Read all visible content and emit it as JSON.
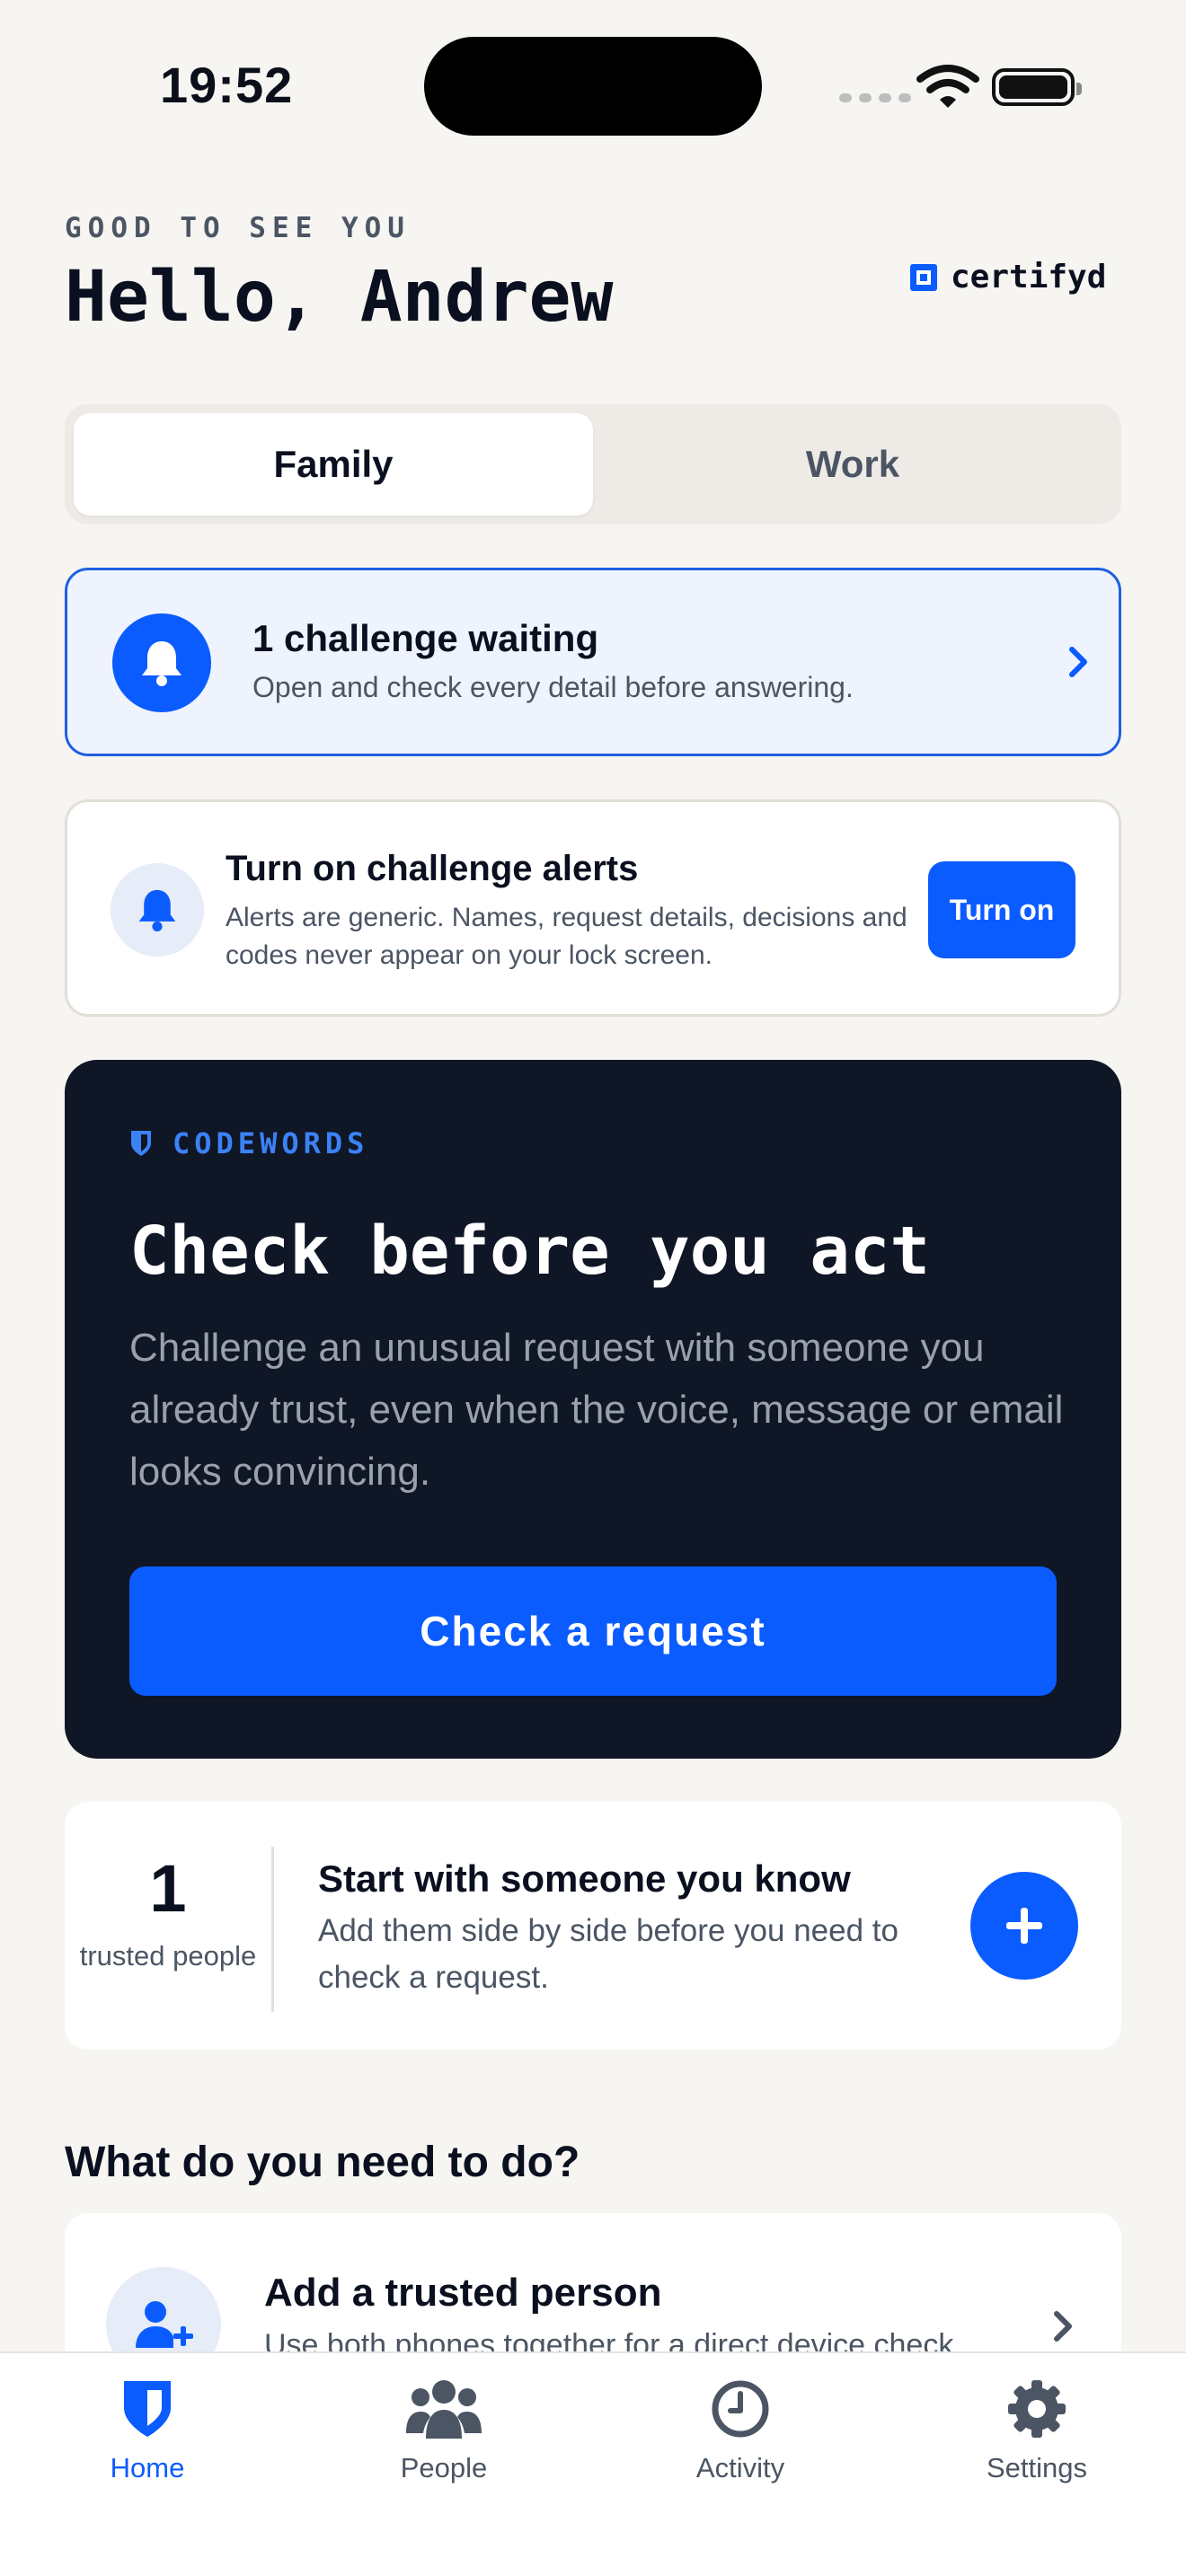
{
  "status_bar": {
    "time": "19:52"
  },
  "header": {
    "eyebrow": "GOOD TO SEE YOU",
    "greeting": "Hello, Andrew",
    "brand": "certifyd"
  },
  "segmented": {
    "tabs": [
      "Family",
      "Work"
    ],
    "selected": "Family"
  },
  "challenge_card": {
    "title": "1 challenge waiting",
    "subtitle": "Open and check every detail before answering."
  },
  "alerts_card": {
    "title": "Turn on challenge alerts",
    "subtitle": "Alerts are generic. Names, request details, decisions and codes never appear on your lock screen.",
    "button": "Turn on"
  },
  "codewords_card": {
    "label": "CODEWORDS",
    "title": "Check before you act",
    "body": "Challenge an unusual request with someone you already trust, even when the voice, message or email looks convincing.",
    "button": "Check a request"
  },
  "trusted_card": {
    "count": "1",
    "count_label": "trusted people",
    "title": "Start with someone you know",
    "subtitle": "Add them side by side before you need to check a request."
  },
  "actions": {
    "section_title": "What do you need to do?",
    "items": [
      {
        "title": "Add a trusted person",
        "subtitle": "Use both phones together for a direct device check"
      }
    ]
  },
  "tabbar": {
    "tabs": [
      {
        "label": "Home",
        "icon": "shield-icon"
      },
      {
        "label": "People",
        "icon": "people-icon"
      },
      {
        "label": "Activity",
        "icon": "clock-icon"
      },
      {
        "label": "Settings",
        "icon": "gear-icon"
      }
    ],
    "active": "Home"
  },
  "colors": {
    "accent": "#0b5cff",
    "background": "#f6f5f2",
    "dark_card": "#0f1626",
    "challenge_bg": "#eef3fd"
  }
}
